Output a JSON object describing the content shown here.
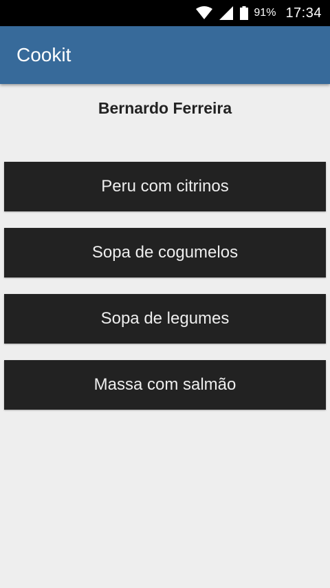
{
  "status_bar": {
    "battery_percent": "91%",
    "time": "17:34",
    "icons": [
      "wifi-icon",
      "signal-icon",
      "battery-icon"
    ]
  },
  "app_bar": {
    "title": "Cookit",
    "color": "#376a9a"
  },
  "user": {
    "name": "Bernardo Ferreira"
  },
  "recipes": [
    {
      "label": "Peru com citrinos"
    },
    {
      "label": "Sopa de cogumelos"
    },
    {
      "label": "Sopa de legumes"
    },
    {
      "label": "Massa com salmão"
    }
  ]
}
